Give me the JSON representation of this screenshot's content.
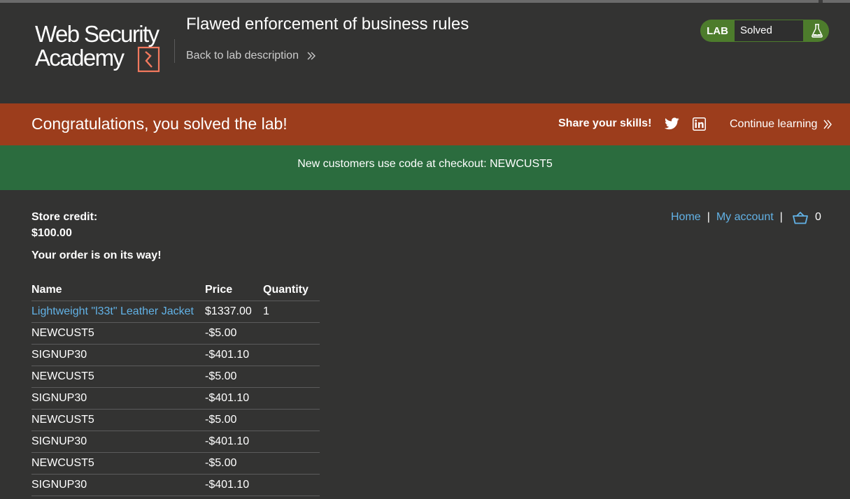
{
  "header": {
    "logo_alt": "Web Security Academy",
    "lab_title": "Flawed enforcement of business rules",
    "back_link": "Back to lab description",
    "lab_badge": "LAB",
    "lab_status": "Solved"
  },
  "banner": {
    "message": "Congratulations, you solved the lab!",
    "share": "Share your skills!",
    "continue": "Continue learning"
  },
  "notice": {
    "text": "New customers use code at checkout: NEWCUST5"
  },
  "account": {
    "credit_label": "Store credit:",
    "credit_value": "$100.00",
    "order_message": "Your order is on its way!"
  },
  "nav": {
    "home": "Home",
    "my_account": "My account",
    "separator": "|",
    "cart_count": "0"
  },
  "order_table": {
    "headers": [
      "Name",
      "Price",
      "Quantity"
    ],
    "rows": [
      {
        "name": "Lightweight \"l33t\" Leather Jacket",
        "price": "$1337.00",
        "qty": "1"
      },
      {
        "name": "NEWCUST5",
        "price": "-$5.00",
        "qty": ""
      },
      {
        "name": "SIGNUP30",
        "price": "-$401.10",
        "qty": ""
      },
      {
        "name": "NEWCUST5",
        "price": "-$5.00",
        "qty": ""
      },
      {
        "name": "SIGNUP30",
        "price": "-$401.10",
        "qty": ""
      },
      {
        "name": "NEWCUST5",
        "price": "-$5.00",
        "qty": ""
      },
      {
        "name": "SIGNUP30",
        "price": "-$401.10",
        "qty": ""
      },
      {
        "name": "NEWCUST5",
        "price": "-$5.00",
        "qty": ""
      },
      {
        "name": "SIGNUP30",
        "price": "-$401.10",
        "qty": ""
      }
    ]
  },
  "colors": {
    "background": "#333332",
    "banner": "#9c3d1c",
    "notice": "#2b6c3e",
    "link": "#62b2e6",
    "lab_badge": "#4d7c2c",
    "logo_accent": "#f2795e"
  },
  "icons": [
    "flask-icon",
    "twitter-icon",
    "linkedin-icon",
    "chevron-double-right-icon",
    "basket-icon"
  ]
}
